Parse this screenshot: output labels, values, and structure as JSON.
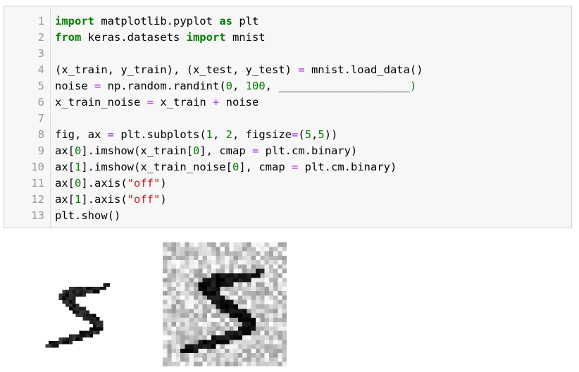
{
  "code_cell": {
    "lines": [
      {
        "number": "1",
        "tokens": [
          {
            "t": "import",
            "c": "kw"
          },
          {
            "t": " matplotlib.pyplot ",
            "c": ""
          },
          {
            "t": "as",
            "c": "kw"
          },
          {
            "t": " plt",
            "c": ""
          }
        ]
      },
      {
        "number": "2",
        "tokens": [
          {
            "t": "from",
            "c": "kw"
          },
          {
            "t": " keras.datasets ",
            "c": ""
          },
          {
            "t": "import",
            "c": "kw"
          },
          {
            "t": " mnist",
            "c": ""
          }
        ]
      },
      {
        "number": "3",
        "tokens": []
      },
      {
        "number": "4",
        "tokens": [
          {
            "t": "(x_train, y_train), (x_test, y_test) ",
            "c": ""
          },
          {
            "t": "=",
            "c": "op"
          },
          {
            "t": " mnist.load_data()",
            "c": ""
          }
        ]
      },
      {
        "number": "5",
        "tokens": [
          {
            "t": "noise ",
            "c": ""
          },
          {
            "t": "=",
            "c": "op"
          },
          {
            "t": " np.random.randint(",
            "c": ""
          },
          {
            "t": "0",
            "c": "num"
          },
          {
            "t": ", ",
            "c": ""
          },
          {
            "t": "100",
            "c": "num"
          },
          {
            "t": ", ____________________",
            "c": ""
          },
          {
            "t": ")",
            "c": "num"
          }
        ]
      },
      {
        "number": "6",
        "tokens": [
          {
            "t": "x_train_noise ",
            "c": ""
          },
          {
            "t": "=",
            "c": "op"
          },
          {
            "t": " x_train ",
            "c": ""
          },
          {
            "t": "+",
            "c": "op"
          },
          {
            "t": " noise",
            "c": ""
          }
        ]
      },
      {
        "number": "7",
        "tokens": []
      },
      {
        "number": "8",
        "tokens": [
          {
            "t": "fig, ax ",
            "c": ""
          },
          {
            "t": "=",
            "c": "op"
          },
          {
            "t": " plt.subplots(",
            "c": ""
          },
          {
            "t": "1",
            "c": "num"
          },
          {
            "t": ", ",
            "c": ""
          },
          {
            "t": "2",
            "c": "num"
          },
          {
            "t": ", figsize",
            "c": ""
          },
          {
            "t": "=",
            "c": "op"
          },
          {
            "t": "(",
            "c": ""
          },
          {
            "t": "5",
            "c": "num"
          },
          {
            "t": ",",
            "c": ""
          },
          {
            "t": "5",
            "c": "num"
          },
          {
            "t": "))",
            "c": ""
          }
        ]
      },
      {
        "number": "9",
        "tokens": [
          {
            "t": "ax[",
            "c": ""
          },
          {
            "t": "0",
            "c": "num"
          },
          {
            "t": "].imshow(x_train[",
            "c": ""
          },
          {
            "t": "0",
            "c": "num"
          },
          {
            "t": "], cmap ",
            "c": ""
          },
          {
            "t": "=",
            "c": "op"
          },
          {
            "t": " plt.cm.binary)",
            "c": ""
          }
        ]
      },
      {
        "number": "10",
        "tokens": [
          {
            "t": "ax[",
            "c": ""
          },
          {
            "t": "1",
            "c": "num"
          },
          {
            "t": "].imshow(x_train_noise[",
            "c": ""
          },
          {
            "t": "0",
            "c": "num"
          },
          {
            "t": "], cmap ",
            "c": ""
          },
          {
            "t": "=",
            "c": "op"
          },
          {
            "t": " plt.cm.binary)",
            "c": ""
          }
        ]
      },
      {
        "number": "11",
        "tokens": [
          {
            "t": "ax[",
            "c": ""
          },
          {
            "t": "0",
            "c": "num"
          },
          {
            "t": "].axis(",
            "c": ""
          },
          {
            "t": "\"off\"",
            "c": "str"
          },
          {
            "t": ")",
            "c": ""
          }
        ]
      },
      {
        "number": "12",
        "tokens": [
          {
            "t": "ax[",
            "c": ""
          },
          {
            "t": "1",
            "c": "num"
          },
          {
            "t": "].axis(",
            "c": ""
          },
          {
            "t": "\"off\"",
            "c": "str"
          },
          {
            "t": ")",
            "c": ""
          }
        ]
      },
      {
        "number": "13",
        "tokens": [
          {
            "t": "plt.show()",
            "c": ""
          }
        ]
      }
    ]
  },
  "output": {
    "images": [
      {
        "name": "mnist-digit-clean",
        "depicts": "handwritten digit 5 (clean)"
      },
      {
        "name": "mnist-digit-noisy",
        "depicts": "handwritten digit 5 with random noise"
      }
    ]
  }
}
